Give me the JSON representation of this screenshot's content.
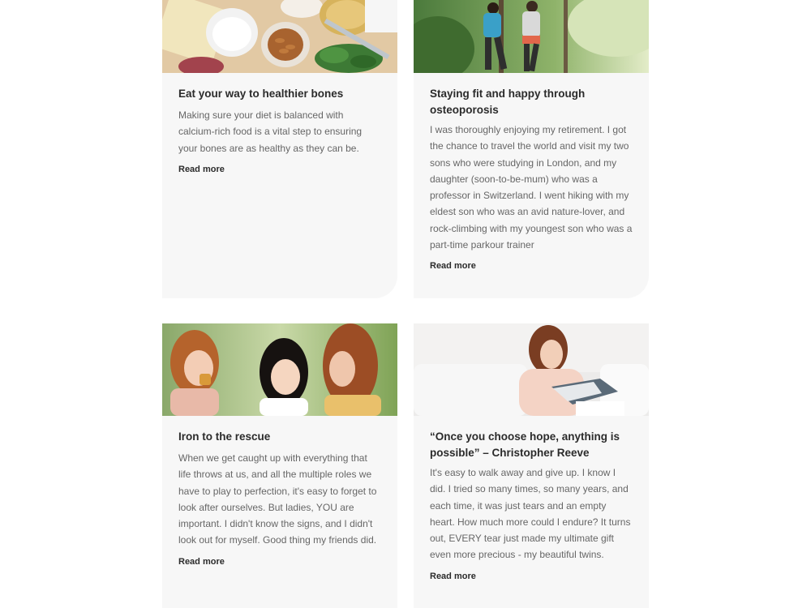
{
  "cards": [
    {
      "title": "Eat your way to healthier bones",
      "text": "Making sure your diet is balanced with calcium-rich food is a vital step to ensuring your bones are as healthy as they can be.",
      "link": "Read more",
      "image": "food-ingredients-image"
    },
    {
      "title": "Staying fit and happy through osteoporosis",
      "text": "I was thoroughly enjoying my retirement. I got the chance to travel the world and visit my two sons who were studying in London, and my daughter (soon-to-be-mum) who was a professor in Switzerland. I went hiking with my eldest son who was an avid nature-lover, and rock-climbing with my youngest son who was a part-time parkour trainer",
      "link": "Read more",
      "image": "women-jogging-image"
    },
    {
      "title": "Iron to the rescue",
      "text": "When we get caught up with everything that life throws at us, and all the multiple roles we have to play to perfection, it's easy to forget to look after ourselves. But ladies, YOU are important. I didn't know the signs, and I didn't look out for myself. Good thing my friends did.",
      "link": "Read more",
      "image": "friends-laughing-image"
    },
    {
      "title": "“Once you choose hope, anything is possible” – Christopher Reeve",
      "text": "It's easy to walk away and give up. I know I did. I tried so many times, so many years, and each time, it was just tears and an empty heart. How much more could I endure? It turns out, EVERY tear just made my ultimate gift even more precious - my beautiful twins.",
      "link": "Read more",
      "image": "woman-reading-image"
    }
  ],
  "colors": {
    "card_bg": "#f7f7f7",
    "title": "#2b2b2b",
    "body_text": "#666666"
  }
}
